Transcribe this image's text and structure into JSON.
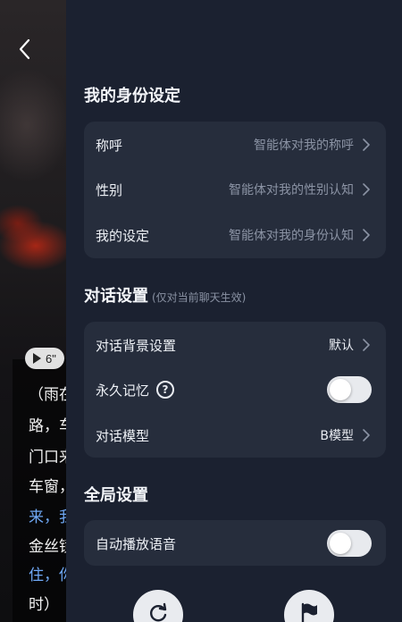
{
  "background": {
    "play_badge_duration": "6\"",
    "chat_lines": [
      {
        "text": "（雨在",
        "color": "white"
      },
      {
        "text": "路，车",
        "color": "white"
      },
      {
        "text": "门口来",
        "color": "white"
      },
      {
        "text": "车窗，",
        "color": "white"
      },
      {
        "text": "来，我",
        "color": "blue"
      },
      {
        "text": "金丝镜",
        "color": "white"
      },
      {
        "text": "住，你",
        "color": "blue"
      },
      {
        "text": "时）",
        "color": "white"
      }
    ]
  },
  "identity": {
    "title": "我的身份设定",
    "rows": [
      {
        "label": "称呼",
        "value": "智能体对我的称呼"
      },
      {
        "label": "性别",
        "value": "智能体对我的性别认知"
      },
      {
        "label": "我的设定",
        "value": "智能体对我的身份认知"
      }
    ]
  },
  "dialog": {
    "title": "对话设置",
    "subtitle": "(仅对当前聊天生效)",
    "background_label": "对话背景设置",
    "background_value": "默认",
    "memory_label": "永久记忆",
    "memory_help": "?",
    "memory_on": false,
    "model_label": "对话模型",
    "model_value": "B模型"
  },
  "global": {
    "title": "全局设置",
    "autoplay_label": "自动播放语音",
    "autoplay_on": false
  },
  "colors": {
    "panel": "#1b2130",
    "card": "#262d3c",
    "accent_blue": "#6fa8f5"
  }
}
